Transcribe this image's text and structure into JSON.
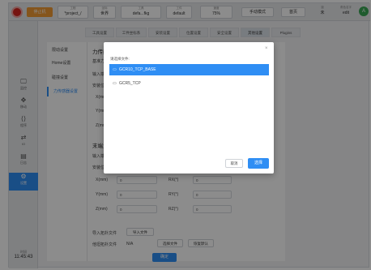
{
  "topbar": {
    "mode_label": "停止机",
    "project": {
      "caption": "工程",
      "value": "*project_/"
    },
    "tool_label": {
      "caption": "坐标",
      "value": "世界"
    },
    "user_frame": {
      "caption": "工具",
      "value": "defa...fkg"
    },
    "workpiece": {
      "caption": "工件",
      "value": "default"
    },
    "speed": {
      "caption": "速度",
      "value": "75%"
    },
    "manual_btn": "手动模式",
    "home_btn": "首页",
    "lock": {
      "caption": "锁",
      "value": "未"
    },
    "user": {
      "caption": "角色名字",
      "value": "edit"
    },
    "avatar_letter": "A"
  },
  "leftnav": {
    "items": [
      {
        "icon": "🖵",
        "label": "监控"
      },
      {
        "icon": "✥",
        "label": "移动"
      },
      {
        "icon": "⟨⟩",
        "label": "程序"
      },
      {
        "icon": "⇄",
        "label": "IO"
      },
      {
        "icon": "▤",
        "label": "日志"
      },
      {
        "icon": "⚙",
        "label": "设置"
      }
    ],
    "clock_caption": "时间",
    "clock_time": "11:45:43"
  },
  "tabs": [
    "工具设置",
    "工件坐标系",
    "安装设置",
    "位置设置",
    "安全设置",
    "其他设置",
    "Plugins"
  ],
  "submenu": [
    "限动设置",
    "Home设置",
    "碰撞设置",
    "力传感器设置"
  ],
  "content": {
    "section_title": "力传感器",
    "row_base_force": "基准力传感",
    "row_input_port": "输入端口",
    "row_install_pos": "安装位置",
    "x_label": "X(mm)",
    "y_label": "Y(mm)",
    "z_label": "Z(mm)",
    "section2_title": "末端力传感",
    "row2_input_port": "输入端口",
    "row2_install_pos": "安装位置",
    "x2_label": "X(mm)",
    "y2_label": "Y(mm)",
    "z2_label": "Z(mm)",
    "rx_label": "RX(°)",
    "ry_label": "RY(°)",
    "rz_label": "RZ(°)",
    "x2_value": "0",
    "y2_value": "0",
    "z2_value": "0",
    "rx_value": "0",
    "ry_value": "0",
    "rz_value": "0",
    "import_label": "导入拓扑文件",
    "import_btn": "导入文件",
    "topo_label": "他坦拓扑文件",
    "topo_value": "N/A",
    "select_btn": "选择文件",
    "default_btn": "恢复默认",
    "confirm_btn": "确定"
  },
  "modal": {
    "label": "请选择文件:",
    "files": [
      "GCR10_TCP_BASE",
      "GCR5_TCP"
    ],
    "selected_index": 0,
    "cancel": "取消",
    "ok": "选择"
  }
}
